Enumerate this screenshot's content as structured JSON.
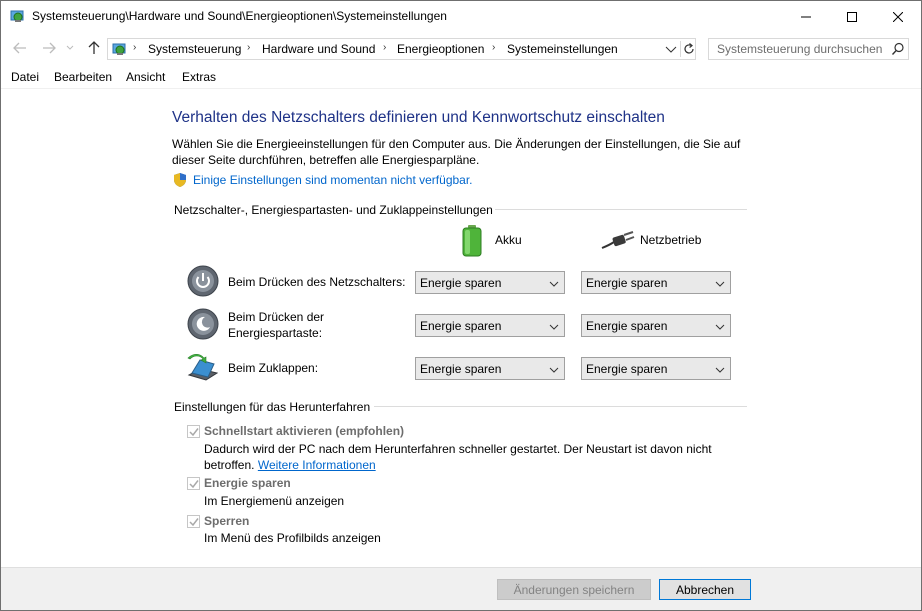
{
  "window": {
    "title": "Systemsteuerung\\Hardware und Sound\\Energieoptionen\\Systemeinstellungen"
  },
  "address": {
    "crumbs": [
      "Systemsteuerung",
      "Hardware und Sound",
      "Energieoptionen",
      "Systemeinstellungen"
    ],
    "search_placeholder": "Systemsteuerung durchsuchen"
  },
  "menu": [
    "Datei",
    "Bearbeiten",
    "Ansicht",
    "Extras"
  ],
  "page": {
    "heading": "Verhalten des Netzschalters definieren und Kennwortschutz einschalten",
    "description": "Wählen Sie die Energieeinstellungen für den Computer aus. Die Änderungen der Einstellungen, die Sie auf dieser Seite durchführen, betreffen alle Energiesparpläne.",
    "shield_link": "Einige Einstellungen sind momentan nicht verfügbar."
  },
  "power_section": {
    "title": "Netzschalter-, Energiespartasten- und Zuklappeinstellungen",
    "col_battery": "Akku",
    "col_plugged": "Netzbetrieb",
    "rows": [
      {
        "label": "Beim Drücken des Netzschalters:",
        "battery": "Energie sparen",
        "plugged": "Energie sparen"
      },
      {
        "label": "Beim Drücken der Energiespartaste:",
        "battery": "Energie sparen",
        "plugged": "Energie sparen"
      },
      {
        "label": "Beim Zuklappen:",
        "battery": "Energie sparen",
        "plugged": "Energie sparen"
      }
    ]
  },
  "shutdown_section": {
    "title": "Einstellungen für das Herunterfahren",
    "items": [
      {
        "label": "Schnellstart aktivieren (empfohlen)",
        "checked": true,
        "desc": "Dadurch wird der PC nach dem Herunterfahren schneller gestartet. Der Neustart ist davon nicht betroffen.",
        "link": "Weitere Informationen"
      },
      {
        "label": "Energie sparen",
        "checked": true,
        "desc": "Im Energiemenü anzeigen"
      },
      {
        "label": "Sperren",
        "checked": true,
        "desc": "Im Menü des Profilbilds anzeigen"
      }
    ]
  },
  "buttons": {
    "save": "Änderungen speichern",
    "cancel": "Abbrechen"
  },
  "colors": {
    "heading": "#1e3287",
    "link": "#0066cc",
    "accent": "#0078d7"
  }
}
